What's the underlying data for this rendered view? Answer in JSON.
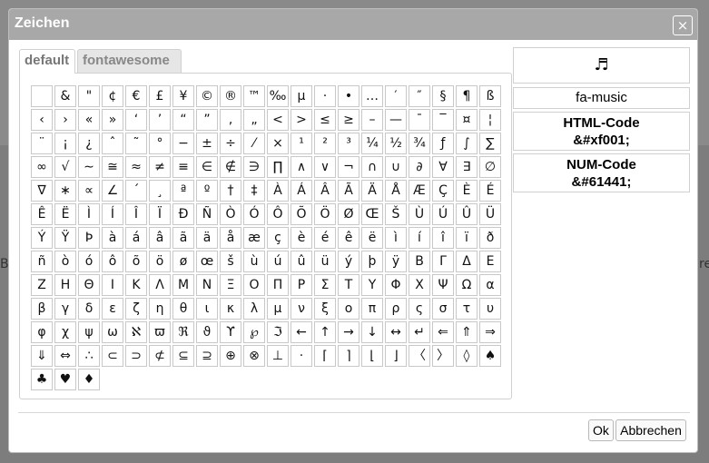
{
  "dialog": {
    "title": "Zeichen",
    "close_symbol": "×"
  },
  "tabs": [
    {
      "label": "default",
      "active": true
    },
    {
      "label": "fontawesome",
      "active": false
    }
  ],
  "preview": {
    "glyph": "♬",
    "name": "fa-music",
    "html_label": "HTML-Code",
    "html_value": "&#xf001;",
    "num_label": "NUM-Code",
    "num_value": "&#61441;"
  },
  "buttons": {
    "ok": "Ok",
    "cancel": "Abbrechen"
  },
  "backdrop": {
    "left_fragment": "Be",
    "right_fragment": "re"
  },
  "characters": [
    " ",
    "&",
    "\"",
    "¢",
    "€",
    "£",
    "¥",
    "©",
    "®",
    "™",
    "‰",
    "µ",
    "·",
    "•",
    "…",
    "′",
    "″",
    "§",
    "¶",
    "ß",
    "‹",
    "›",
    "«",
    "»",
    "‘",
    "’",
    "“",
    "”",
    "‚",
    "„",
    "<",
    ">",
    "≤",
    "≥",
    "–",
    "—",
    "¯",
    "‾",
    "¤",
    "¦",
    "¨",
    "¡",
    "¿",
    "ˆ",
    "˜",
    "°",
    "−",
    "±",
    "÷",
    "⁄",
    "×",
    "¹",
    "²",
    "³",
    "¼",
    "½",
    "¾",
    "ƒ",
    "∫",
    "∑",
    "∞",
    "√",
    "∼",
    "≅",
    "≈",
    "≠",
    "≡",
    "∈",
    "∉",
    "∋",
    "∏",
    "∧",
    "∨",
    "¬",
    "∩",
    "∪",
    "∂",
    "∀",
    "∃",
    "∅",
    "∇",
    "∗",
    "∝",
    "∠",
    "´",
    "¸",
    "ª",
    "º",
    "†",
    "‡",
    "À",
    "Á",
    "Â",
    "Ã",
    "Ä",
    "Å",
    "Æ",
    "Ç",
    "È",
    "É",
    "Ê",
    "Ë",
    "Ì",
    "Í",
    "Î",
    "Ï",
    "Ð",
    "Ñ",
    "Ò",
    "Ó",
    "Ô",
    "Õ",
    "Ö",
    "Ø",
    "Œ",
    "Š",
    "Ù",
    "Ú",
    "Û",
    "Ü",
    "Ý",
    "Ÿ",
    "Þ",
    "à",
    "á",
    "â",
    "ã",
    "ä",
    "å",
    "æ",
    "ç",
    "è",
    "é",
    "ê",
    "ë",
    "ì",
    "í",
    "î",
    "ï",
    "ð",
    "ñ",
    "ò",
    "ó",
    "ô",
    "õ",
    "ö",
    "ø",
    "œ",
    "š",
    "ù",
    "ú",
    "û",
    "ü",
    "ý",
    "þ",
    "ÿ",
    "Β",
    "Γ",
    "Δ",
    "Ε",
    "Ζ",
    "Η",
    "Θ",
    "Ι",
    "Κ",
    "Λ",
    "Μ",
    "Ν",
    "Ξ",
    "Ο",
    "Π",
    "Ρ",
    "Σ",
    "Τ",
    "Υ",
    "Φ",
    "Χ",
    "Ψ",
    "Ω",
    "α",
    "β",
    "γ",
    "δ",
    "ε",
    "ζ",
    "η",
    "θ",
    "ι",
    "κ",
    "λ",
    "μ",
    "ν",
    "ξ",
    "ο",
    "π",
    "ρ",
    "ς",
    "σ",
    "τ",
    "υ",
    "φ",
    "χ",
    "ψ",
    "ω",
    "ℵ",
    "ϖ",
    "ℜ",
    "ϑ",
    "ϒ",
    "℘",
    "ℑ",
    "←",
    "↑",
    "→",
    "↓",
    "↔",
    "↵",
    "⇐",
    "⇑",
    "⇒",
    "⇓",
    "⇔",
    "∴",
    "⊂",
    "⊃",
    "⊄",
    "⊆",
    "⊇",
    "⊕",
    "⊗",
    "⊥",
    "⋅",
    "⌈",
    "⌉",
    "⌊",
    "⌋",
    "〈",
    "〉",
    "◊",
    "♠",
    "♣",
    "♥",
    "♦"
  ]
}
